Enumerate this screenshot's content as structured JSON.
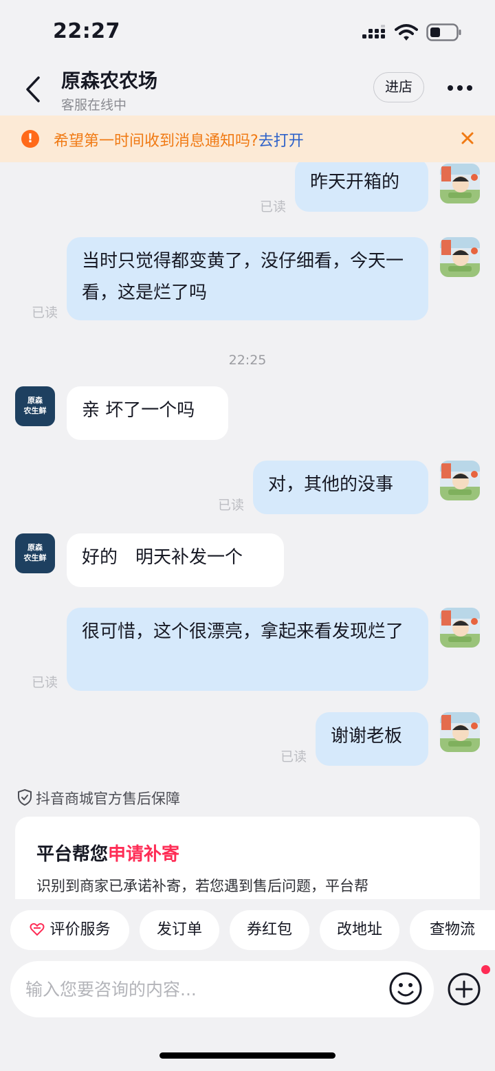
{
  "status_bar": {
    "time": "22:27"
  },
  "header": {
    "shop_name": "原森农农场",
    "status": "客服在线中",
    "enter_label": "进店"
  },
  "notice": {
    "icon": "!",
    "text": "希望第一时间收到消息通知吗?",
    "link": "去打开"
  },
  "shop_avatar": {
    "line1": "原森",
    "line2": "农生鲜"
  },
  "messages": [
    {
      "text": "昨天开箱的",
      "read": "已读"
    },
    {
      "text": "当时只觉得都变黄了，没仔细看，今天一看，这是烂了吗",
      "read": "已读"
    },
    {
      "timestamp": "22:25"
    },
    {
      "text": "亲 坏了一个吗"
    },
    {
      "text": "对，其他的没事",
      "read": "已读"
    },
    {
      "text": "好的　明天补发一个"
    },
    {
      "text": "很可惜，这个很漂亮，拿起来看发现烂了",
      "read": "已读"
    },
    {
      "text": "谢谢老板",
      "read": "已读"
    }
  ],
  "guarantee": {
    "label": "抖音商城官方售后保障"
  },
  "card": {
    "title_prefix": "平台帮您",
    "title_highlight": "申请补寄",
    "desc": "识别到商家已承诺补寄，若您遇到售后问题，平台帮"
  },
  "quick_actions": [
    "评价服务",
    "发订单",
    "券红包",
    "改地址",
    "查物流"
  ],
  "input": {
    "placeholder": "输入您要咨询的内容..."
  },
  "colors": {
    "outgoing_bubble": "#d6e9fb",
    "incoming_bubble": "#ffffff",
    "accent": "#fe2c55",
    "notice_text": "#f07a14",
    "notice_link": "#2d61c9"
  }
}
